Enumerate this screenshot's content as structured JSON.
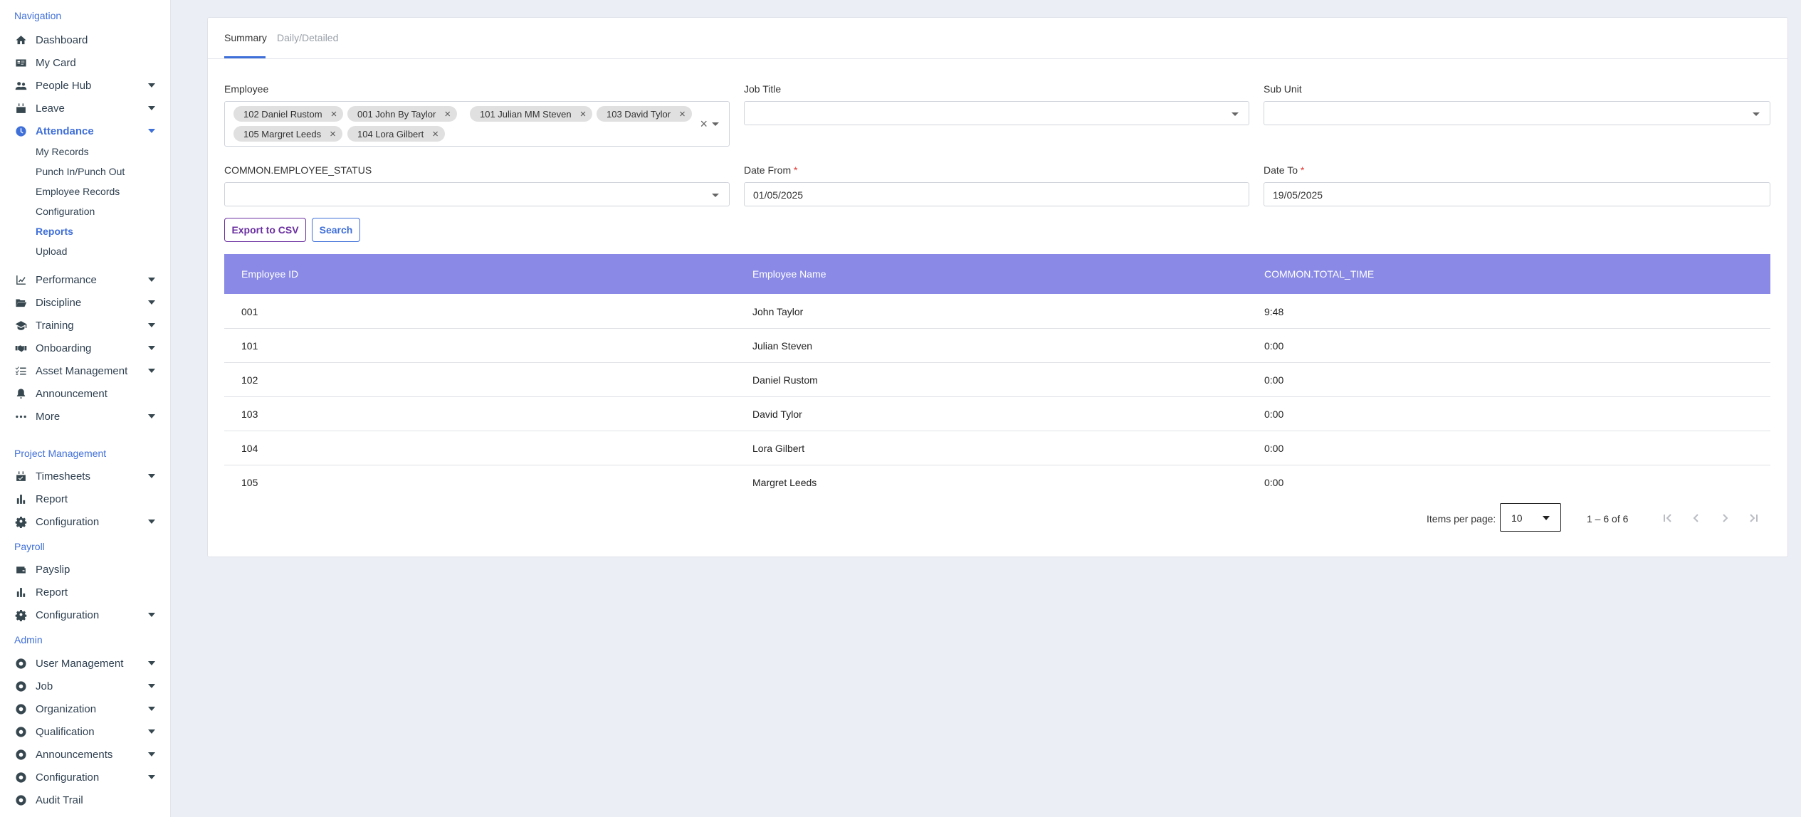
{
  "sidebar": {
    "navigation_title": "Navigation",
    "items": [
      {
        "label": "Dashboard",
        "icon": "home-icon"
      },
      {
        "label": "My Card",
        "icon": "id-card-icon"
      },
      {
        "label": "People Hub",
        "icon": "people-icon"
      },
      {
        "label": "Leave",
        "icon": "calendar-icon"
      },
      {
        "label": "Attendance",
        "icon": "clock-icon"
      },
      {
        "label": "Performance",
        "icon": "chart-line-icon"
      },
      {
        "label": "Discipline",
        "icon": "folder-open-icon"
      },
      {
        "label": "Training",
        "icon": "graduation-cap-icon"
      },
      {
        "label": "Onboarding",
        "icon": "handshake-icon"
      },
      {
        "label": "Asset Management",
        "icon": "checklist-icon"
      },
      {
        "label": "Announcement",
        "icon": "bell-icon"
      },
      {
        "label": "More",
        "icon": "ellipsis-icon"
      }
    ],
    "attendance_sub": [
      "My Records",
      "Punch In/Punch Out",
      "Employee Records",
      "Configuration",
      "Reports",
      "Upload"
    ],
    "project_title": "Project Management",
    "project_items": [
      {
        "label": "Timesheets",
        "icon": "calendar-check-icon"
      },
      {
        "label": "Report",
        "icon": "bar-chart-icon"
      },
      {
        "label": "Configuration",
        "icon": "gear-icon"
      }
    ],
    "payroll_title": "Payroll",
    "payroll_items": [
      {
        "label": "Payslip",
        "icon": "wallet-icon"
      },
      {
        "label": "Report",
        "icon": "bar-chart-icon"
      },
      {
        "label": "Configuration",
        "icon": "gear-icon"
      }
    ],
    "admin_title": "Admin",
    "admin_items": [
      {
        "label": "User Management",
        "icon": "circle-dot-icon"
      },
      {
        "label": "Job",
        "icon": "circle-dot-icon"
      },
      {
        "label": "Organization",
        "icon": "circle-dot-icon"
      },
      {
        "label": "Qualification",
        "icon": "circle-dot-icon"
      },
      {
        "label": "Announcements",
        "icon": "circle-dot-icon"
      },
      {
        "label": "Configuration",
        "icon": "circle-dot-icon"
      },
      {
        "label": "Audit Trail",
        "icon": "circle-dot-icon"
      }
    ]
  },
  "tabs": {
    "summary": "Summary",
    "daily": "Daily/Detailed"
  },
  "filters": {
    "employee_label": "Employee",
    "employee_chips": [
      "102 Daniel Rustom",
      "001 John By Taylor",
      "101 Julian MM Steven",
      "103 David Tylor",
      "105 Margret Leeds",
      "104 Lora Gilbert"
    ],
    "job_title_label": "Job Title",
    "sub_unit_label": "Sub Unit",
    "status_label": "COMMON.EMPLOYEE_STATUS",
    "date_from_label": "Date From",
    "date_from": "01/05/2025",
    "date_to_label": "Date To",
    "date_to": "19/05/2025",
    "required_mark": "*"
  },
  "buttons": {
    "export": "Export to CSV",
    "search": "Search"
  },
  "table": {
    "headers": [
      "Employee ID",
      "Employee Name",
      "COMMON.TOTAL_TIME"
    ],
    "rows": [
      [
        "001",
        "John Taylor",
        "9:48"
      ],
      [
        "101",
        "Julian Steven",
        "0:00"
      ],
      [
        "102",
        "Daniel Rustom",
        "0:00"
      ],
      [
        "103",
        "David Tylor",
        "0:00"
      ],
      [
        "104",
        "Lora Gilbert",
        "0:00"
      ],
      [
        "105",
        "Margret Leeds",
        "0:00"
      ]
    ]
  },
  "pagination": {
    "items_per_page_label": "Items per page:",
    "items_per_page": "10",
    "range": "1 – 6 of 6"
  },
  "colors": {
    "accent": "#3f6fd8",
    "table_header": "#8a8ae6",
    "export_button": "#6a2fa0"
  }
}
